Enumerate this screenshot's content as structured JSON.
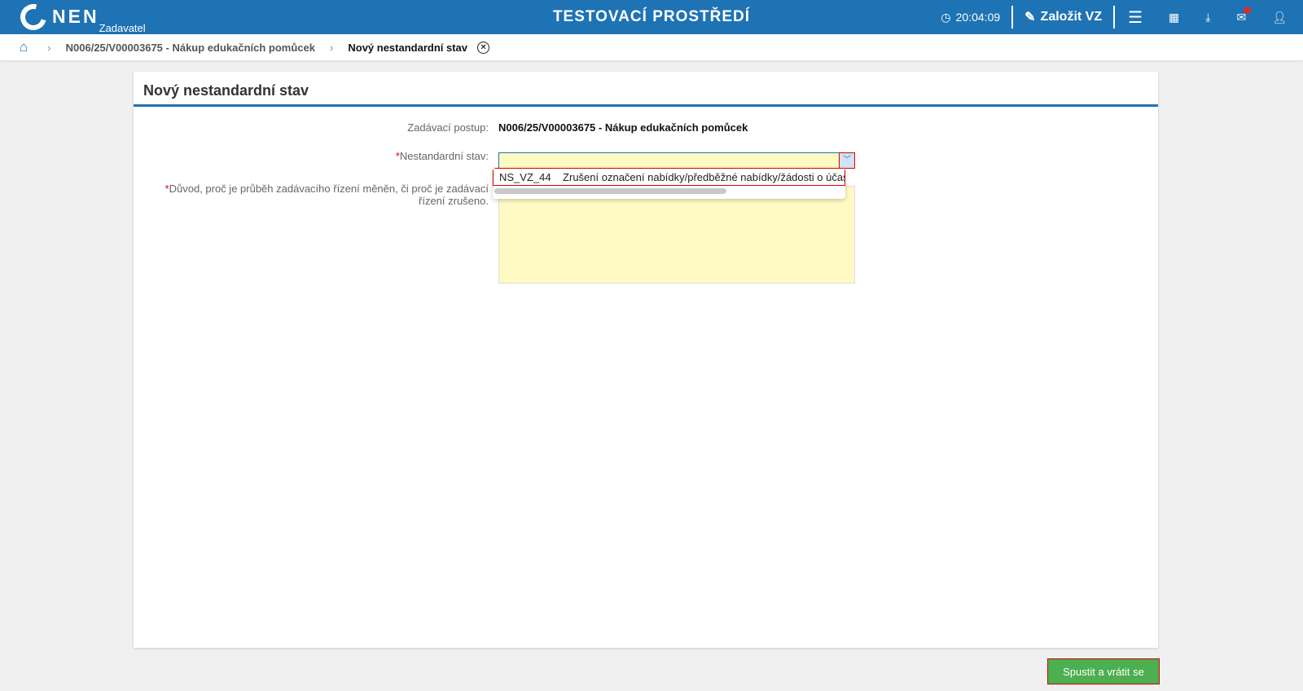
{
  "header": {
    "logo": "NEN",
    "logo_sub": "Zadavatel",
    "title": "TESTOVACÍ PROSTŘEDÍ",
    "time": "20:04:09",
    "create_label": "Založit VZ"
  },
  "breadcrumb": {
    "items": [
      "N006/25/V00003675 - Nákup edukačních pomůcek",
      "Nový nestandardní stav"
    ]
  },
  "form": {
    "title": "Nový nestandardní stav",
    "procedure_label": "Zadávací postup:",
    "procedure_value": "N006/25/V00003675 - Nákup edukačních pomůcek",
    "state_label": "Nestandardní stav:",
    "state_value": "",
    "reason_label": "Důvod, proč je průběh zadávacího řízení měněn, či proč je zadávací řízení zrušeno.",
    "reason_value": "",
    "options": [
      {
        "code": "NS_VZ_44",
        "text": "Zrušení označení nabídky/předběžné nabídky/žádosti o účast"
      }
    ]
  },
  "actions": {
    "submit": "Spustit a vrátit se"
  }
}
